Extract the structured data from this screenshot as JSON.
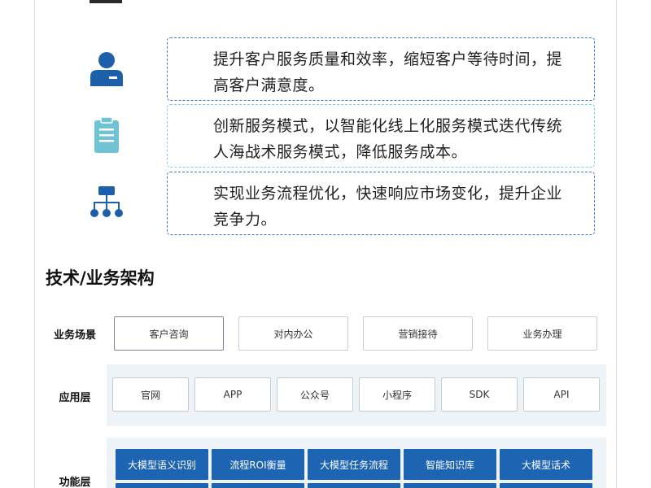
{
  "goals": [
    {
      "icon": "customer-service-person-icon",
      "text": "提升客户服务质量和效率，缩短客户等待时间，提高客户满意度。"
    },
    {
      "icon": "clipboard-icon",
      "text": "创新服务模式，以智能化线上化服务模式迭代传统人海战术服务模式，降低服务成本。"
    },
    {
      "icon": "org-chart-icon",
      "text": "实现业务流程优化，快速响应市场变化，提升企业竞争力。"
    }
  ],
  "architecture": {
    "title": "技术/业务架构",
    "scene_layer": {
      "label": "业务场景",
      "items": [
        "客户咨询",
        "对内办公",
        "营销接待",
        "业务办理"
      ]
    },
    "app_layer": {
      "label": "应用层",
      "items": [
        "官网",
        "APP",
        "公众号",
        "小程序",
        "SDK",
        "API"
      ]
    },
    "function_layer": {
      "label": "功能层",
      "items": [
        "大模型语义识别",
        "流程ROI衡量",
        "大模型任务流程",
        "智能知识库",
        "大模型话术"
      ]
    }
  },
  "colors": {
    "icon_dark_blue": "#1d5fa8",
    "icon_light_blue": "#6fc3d2",
    "function_blue": "#1d64b3",
    "dashed_blue": "#3d7fc6",
    "dashed_cyan": "#7fd0dd",
    "layer_bg": "#eef3f8"
  }
}
